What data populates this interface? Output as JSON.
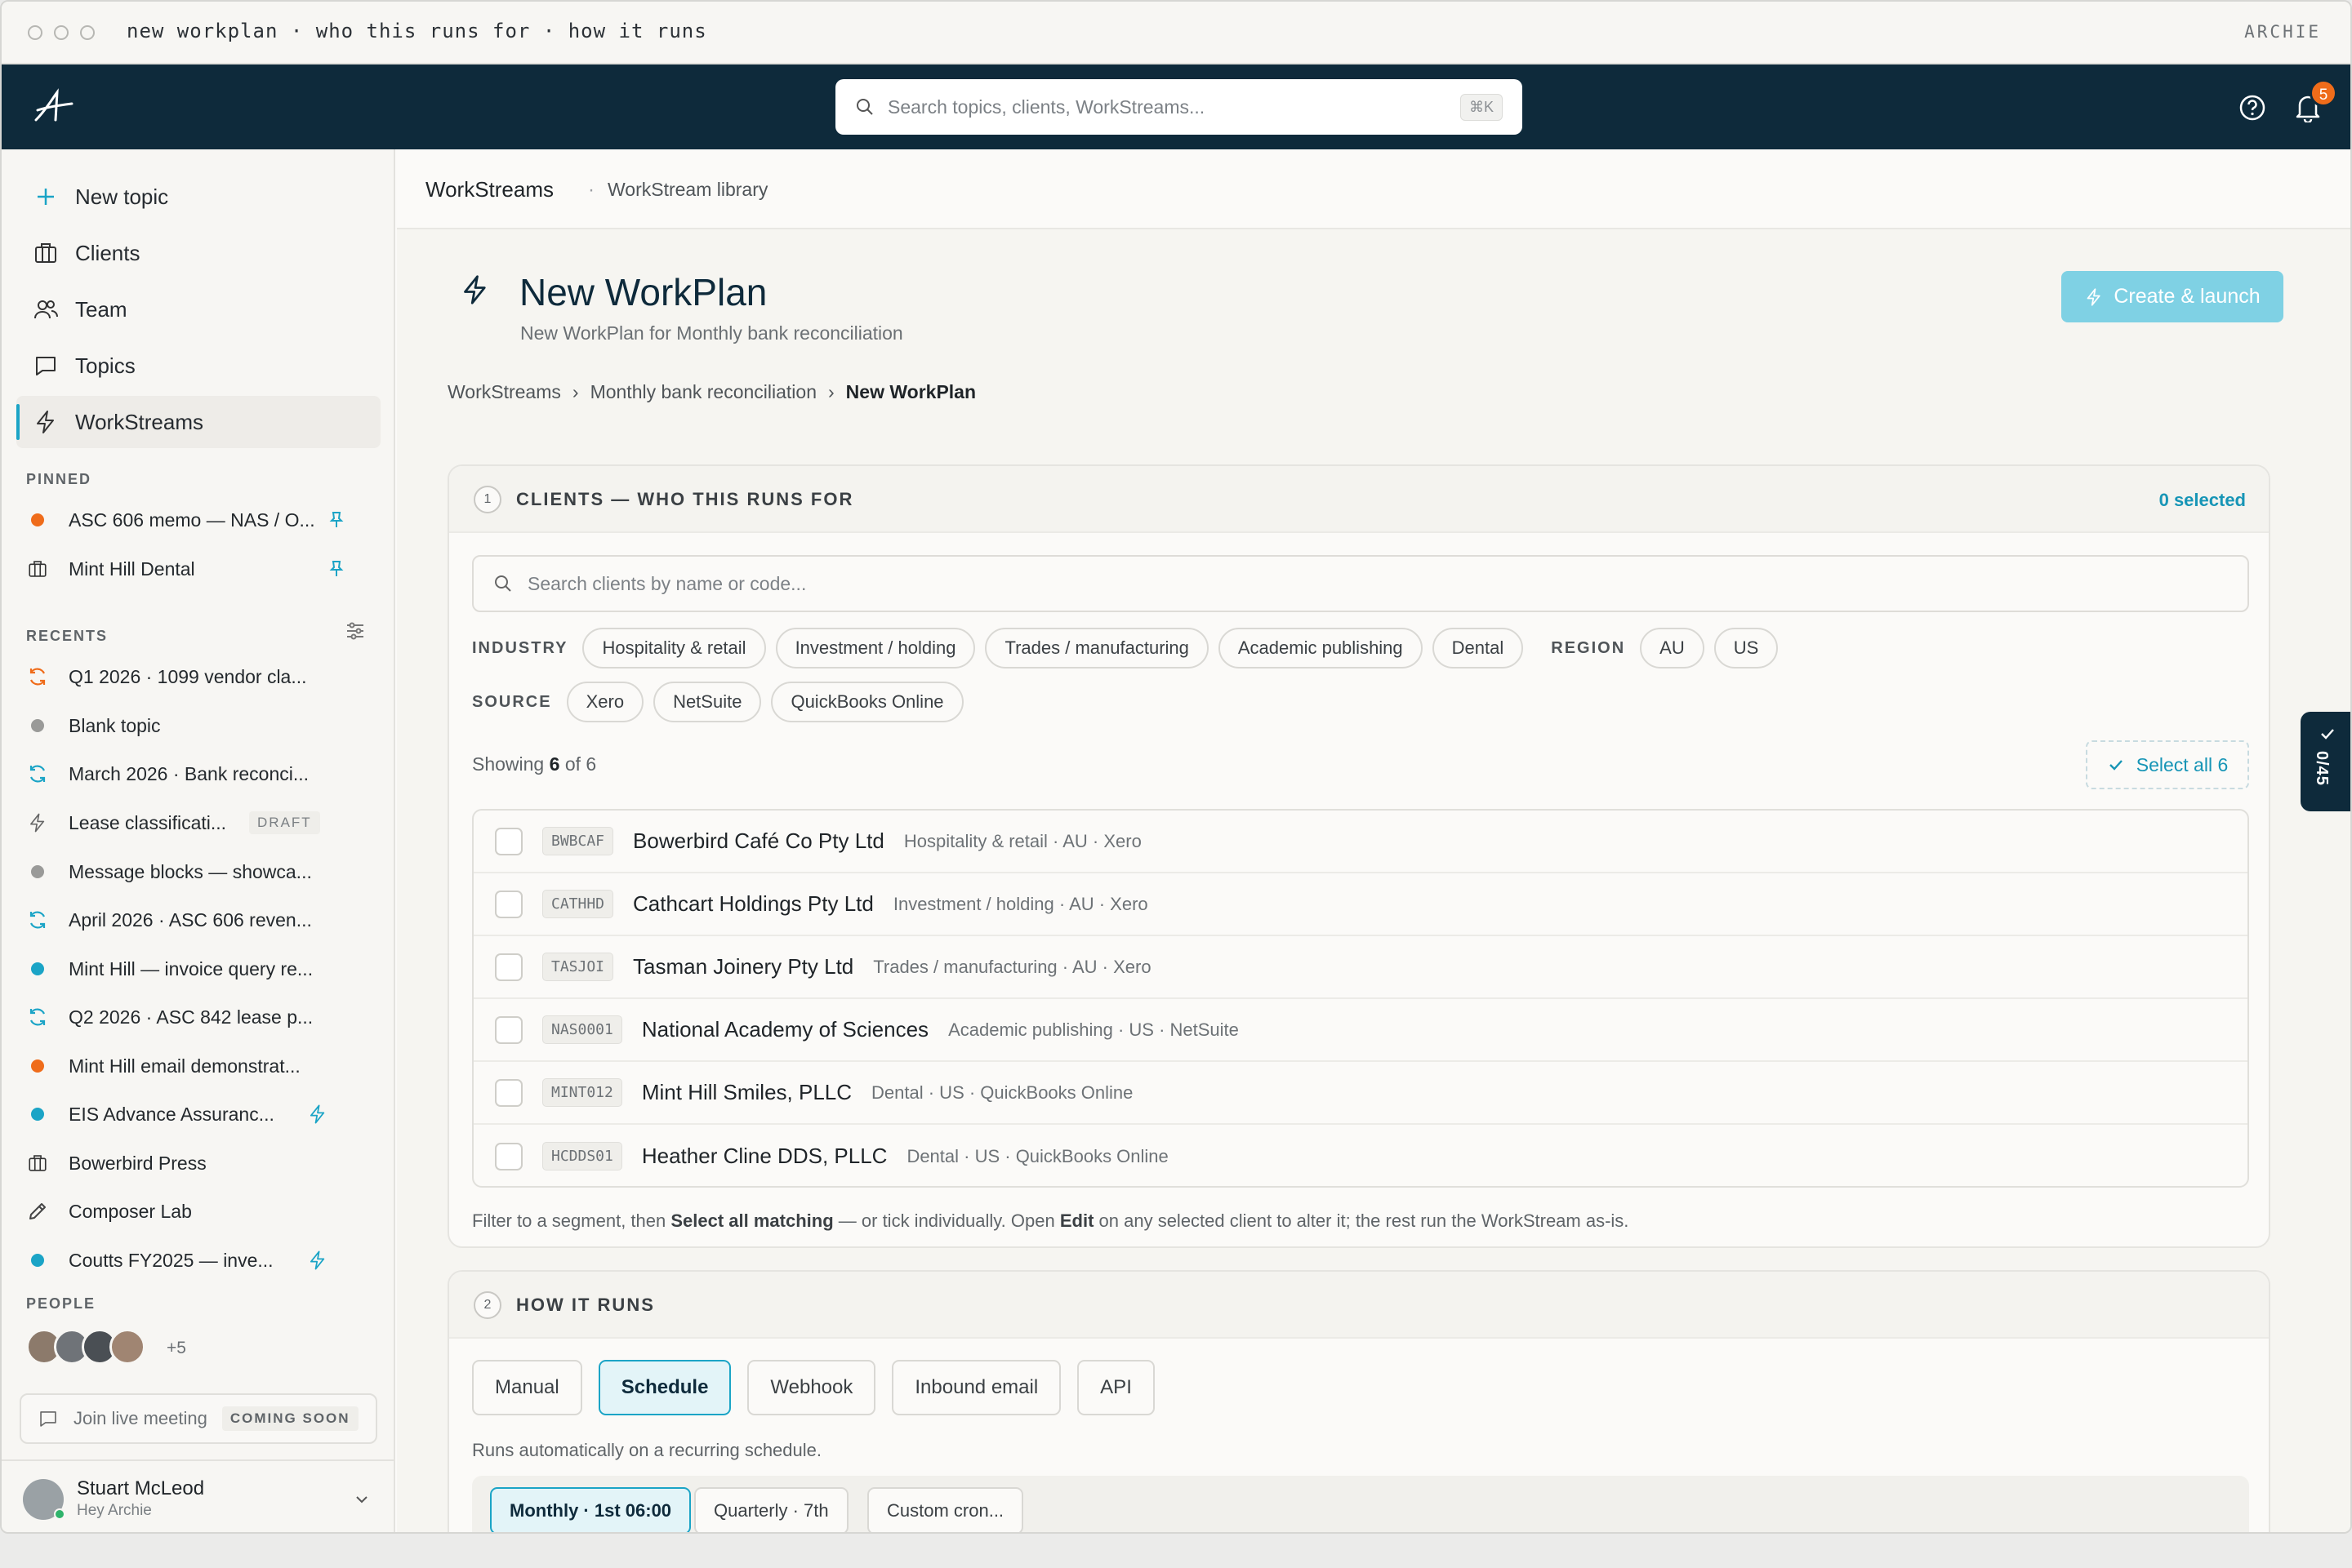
{
  "window": {
    "title": "new workplan · who this runs for · how it runs",
    "app_name": "ARCHIE"
  },
  "topbar": {
    "search_placeholder": "Search topics, clients, WorkStreams...",
    "shortcut": "⌘K",
    "notifications": "5"
  },
  "sidebar": {
    "nav": [
      {
        "label": "New topic",
        "icon": "plus-icon"
      },
      {
        "label": "Clients",
        "icon": "building-icon"
      },
      {
        "label": "Team",
        "icon": "users-icon"
      },
      {
        "label": "Topics",
        "icon": "chat-icon"
      },
      {
        "label": "WorkStreams",
        "icon": "bolt-icon",
        "active": true
      }
    ],
    "pinned_label": "PINNED",
    "pinned": [
      {
        "label": "ASC 606 memo — NAS / O...",
        "marker": "orange-dot"
      },
      {
        "label": "Mint Hill Dental",
        "marker": "building-icon"
      }
    ],
    "recents_label": "RECENTS",
    "recents": [
      {
        "label": "Q1 2026 · 1099 vendor cla...",
        "marker": "refresh-orange-icon"
      },
      {
        "label": "Blank topic",
        "marker": "gray-dot"
      },
      {
        "label": "March 2026 · Bank reconci...",
        "marker": "refresh-blue-icon"
      },
      {
        "label": "Lease classificati...",
        "marker": "bolt-icon",
        "tag": "DRAFT"
      },
      {
        "label": "Message blocks — showca...",
        "marker": "gray-dot"
      },
      {
        "label": "April 2026 · ASC 606 reven...",
        "marker": "refresh-blue-icon"
      },
      {
        "label": "Mint Hill — invoice query re...",
        "marker": "blue-dot"
      },
      {
        "label": "Q2 2026 · ASC 842 lease p...",
        "marker": "refresh-blue-icon"
      },
      {
        "label": "Mint Hill email demonstrat...",
        "marker": "orange-dot"
      },
      {
        "label": "EIS Advance Assuranc...",
        "marker": "blue-dot",
        "bolt": true
      },
      {
        "label": "Bowerbird Press",
        "marker": "building-icon"
      },
      {
        "label": "Composer Lab",
        "marker": "pencil-icon"
      },
      {
        "label": "Coutts FY2025 — inve...",
        "marker": "blue-dot",
        "bolt": true
      }
    ],
    "people_label": "PEOPLE",
    "people_more": "+5",
    "join_label": "Join live meeting",
    "join_tag": "COMING SOON",
    "user": {
      "name": "Stuart McLeod",
      "sub": "Hey Archie"
    }
  },
  "subheader": {
    "title": "WorkStreams",
    "sep": "·",
    "link": "WorkStream library"
  },
  "page": {
    "title": "New WorkPlan",
    "subtitle": "New WorkPlan for Monthly bank reconciliation",
    "launch_label": "Create & launch",
    "crumbs": [
      "WorkStreams",
      "Monthly bank reconciliation",
      "New WorkPlan"
    ]
  },
  "clients_card": {
    "num": "1",
    "title": "CLIENTS — WHO THIS RUNS FOR",
    "selected": "0 selected",
    "search_placeholder": "Search clients by name or code...",
    "industry_label": "INDUSTRY",
    "industries": [
      "Hospitality & retail",
      "Investment / holding",
      "Trades / manufacturing",
      "Academic publishing",
      "Dental"
    ],
    "region_label": "REGION",
    "regions": [
      "AU",
      "US"
    ],
    "source_label": "SOURCE",
    "sources": [
      "Xero",
      "NetSuite",
      "QuickBooks Online"
    ],
    "showing_pre": "Showing",
    "showing_n": "6",
    "showing_post": "of 6",
    "select_all": "Select all 6",
    "clients": [
      {
        "code": "BWBCAF",
        "name": "Bowerbird Café Co Pty Ltd",
        "meta": "Hospitality & retail · AU · Xero"
      },
      {
        "code": "CATHHD",
        "name": "Cathcart Holdings Pty Ltd",
        "meta": "Investment / holding · AU · Xero"
      },
      {
        "code": "TASJOI",
        "name": "Tasman Joinery Pty Ltd",
        "meta": "Trades / manufacturing · AU · Xero"
      },
      {
        "code": "NAS0001",
        "name": "National Academy of Sciences",
        "meta": "Academic publishing · US · NetSuite"
      },
      {
        "code": "MINT012",
        "name": "Mint Hill Smiles, PLLC",
        "meta": "Dental · US · QuickBooks Online"
      },
      {
        "code": "HCDDS01",
        "name": "Heather Cline DDS, PLLC",
        "meta": "Dental · US · QuickBooks Online"
      }
    ],
    "hint_1": "Filter to a segment, then",
    "hint_b1": "Select all matching",
    "hint_2": "— or tick individually. Open",
    "hint_b2": "Edit",
    "hint_3": "on any selected client to alter it; the rest run the WorkStream as-is."
  },
  "how_card": {
    "num": "2",
    "title": "HOW IT RUNS",
    "modes": [
      {
        "label": "Manual"
      },
      {
        "label": "Schedule",
        "active": true
      },
      {
        "label": "Webhook"
      },
      {
        "label": "Inbound email"
      },
      {
        "label": "API"
      }
    ],
    "desc": "Runs automatically on a recurring schedule.",
    "schedules": [
      {
        "label": "Monthly · 1st 06:00",
        "active": true
      },
      {
        "label": "Quarterly · 7th"
      },
      {
        "label": "Custom cron..."
      }
    ]
  },
  "side_tab": {
    "label": "0/45"
  },
  "colors": {
    "navy": "#0e2a3b",
    "accent": "#1ba4c6",
    "orange": "#ef6c1a"
  }
}
